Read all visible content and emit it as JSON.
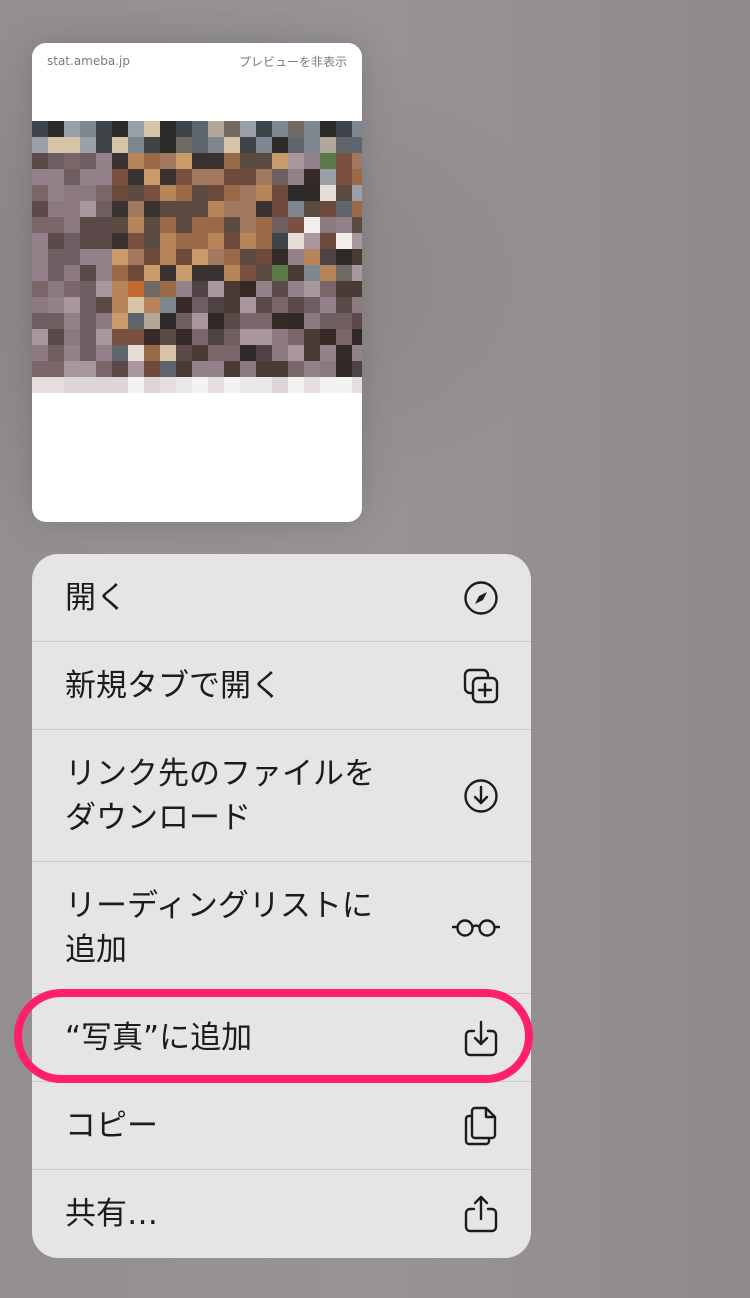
{
  "preview": {
    "domain": "stat.ameba.jp",
    "hide_preview_label": "プレビューを非表示"
  },
  "menu": {
    "items": [
      {
        "label": "開く",
        "icon": "compass-icon"
      },
      {
        "label": "新規タブで開く",
        "icon": "new-tab-icon"
      },
      {
        "label": "リンク先のファイルを\nダウンロード",
        "icon": "download-circle-icon"
      },
      {
        "label": "リーディングリストに\n追加",
        "icon": "glasses-icon"
      },
      {
        "label": "“写真”に追加",
        "icon": "save-to-photos-icon"
      },
      {
        "label": "コピー",
        "icon": "copy-icon"
      },
      {
        "label": "共有…",
        "icon": "share-icon"
      }
    ]
  },
  "highlight_color": "#ff1f6c"
}
